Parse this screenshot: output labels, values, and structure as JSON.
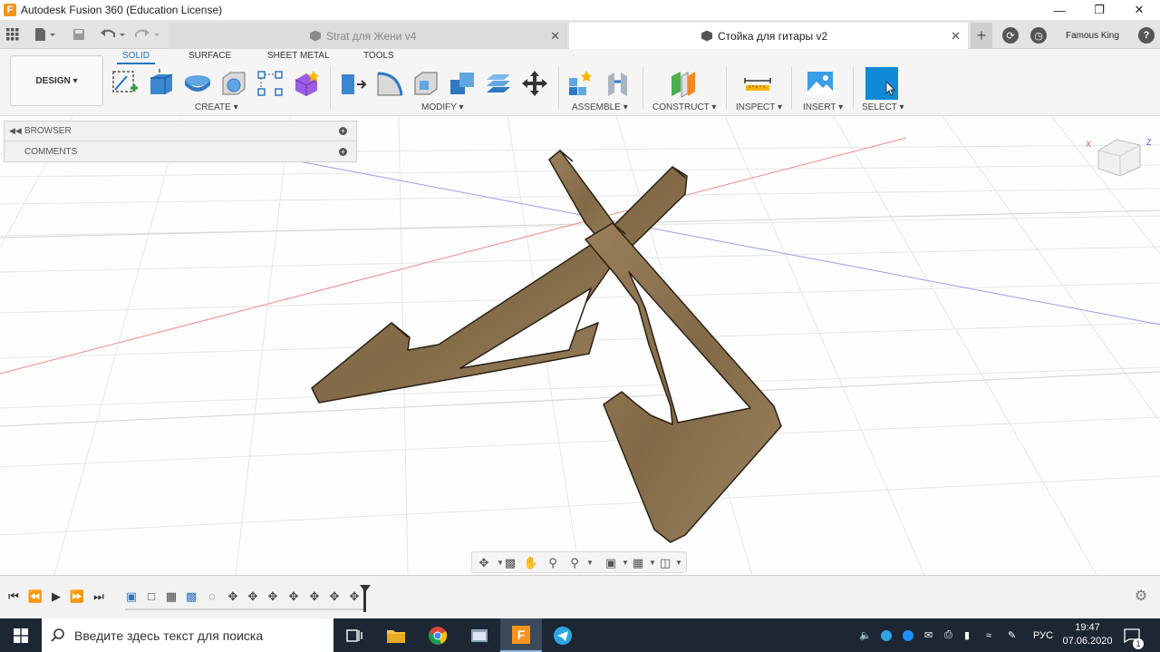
{
  "window": {
    "title": "Autodesk Fusion 360 (Education License)",
    "app_logo_letter": "F"
  },
  "tabs": [
    {
      "label": "Strat для Жени v4",
      "active": false
    },
    {
      "label": "Стойка для гитары v2",
      "active": true
    }
  ],
  "user": {
    "name": "Famous King"
  },
  "workspace": {
    "label": "DESIGN ▾"
  },
  "toolbar_tabs": [
    "SOLID",
    "SURFACE",
    "SHEET METAL",
    "TOOLS"
  ],
  "groups": {
    "create": "CREATE ▾",
    "modify": "MODIFY ▾",
    "assemble": "ASSEMBLE ▾",
    "construct": "CONSTRUCT ▾",
    "inspect": "INSPECT ▾",
    "insert": "INSERT ▾",
    "select": "SELECT ▾"
  },
  "browser": {
    "browser_label": "BROWSER",
    "comments_label": "COMMENTS"
  },
  "viewcube": {
    "x_label": "X",
    "z_label": "Z"
  },
  "taskbar": {
    "search_placeholder": "Введите здесь текст для поиска",
    "language": "РУС",
    "time": "19:47",
    "date": "07.06.2020",
    "notification_count": "1"
  },
  "colors": {
    "accent": "#1a73c4",
    "wood": "#8b7250",
    "taskbar": "#1c2733",
    "select_button": "#0f8ad6"
  }
}
